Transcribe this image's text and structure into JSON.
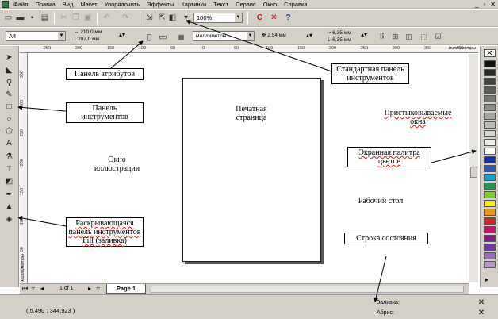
{
  "menu": {
    "items": [
      "Файл",
      "Правка",
      "Вид",
      "Макет",
      "Упорядочить",
      "Эффекты",
      "Картинки",
      "Текст",
      "Сервис",
      "Окно",
      "Справка"
    ],
    "window_controls": [
      "_",
      "▫",
      "✕"
    ]
  },
  "standard_toolbar": {
    "zoom": "100%"
  },
  "property_bar": {
    "page_size": "A4",
    "width": "210.0 мм",
    "height": "297.0 мм",
    "units": "миллиметры",
    "nudge": "2,54 мм",
    "dup_x": "6,35 мм",
    "dup_y": "6,35 мм"
  },
  "rulers": {
    "h_labels": [
      "250",
      "200",
      "150",
      "100",
      "50",
      "0",
      "50",
      "100",
      "150",
      "200",
      "250",
      "300",
      "350",
      "400"
    ],
    "v_labels": [
      "350",
      "300",
      "250",
      "200",
      "150",
      "100",
      "50"
    ],
    "unit": "миллиметры"
  },
  "page_nav": {
    "count": "1 of 1",
    "tab": "Page 1"
  },
  "status": {
    "coords": "( 5,490 ; 344,923 )",
    "fill_label": "Заливка:",
    "outline_label": "Абрис:"
  },
  "palette": {
    "colors": [
      "#111111",
      "#2b2b2b",
      "#444444",
      "#5c5c5c",
      "#747474",
      "#8c8c8c",
      "#a4a4a4",
      "#bcbcbc",
      "#d4d4d4",
      "#ececec",
      "#ffffff",
      "#1a2f9e",
      "#2a55c8",
      "#18a0d0",
      "#12a050",
      "#7ccc2a",
      "#f6ee10",
      "#f29410",
      "#e02020",
      "#c81070",
      "#8a1a8a",
      "#6a3aa0",
      "#9a6ab8",
      "#b89ac8"
    ]
  },
  "annotations": {
    "attr_panel": "Панель атрибутов",
    "tools_panel": "Панель инструментов",
    "illustration_window": "Окно иллюстрации",
    "flyout": "Раскрывающаяся панель инструментов Fill (заливка)",
    "print_page": "Печатная страница",
    "std_panel": "Стандартная панель инструментов",
    "docker_windows": "Пристыковываемые окна",
    "screen_palette": "Экранная палитра цветов",
    "desktop": "Рабочий стол",
    "status_bar": "Строка состояния"
  }
}
